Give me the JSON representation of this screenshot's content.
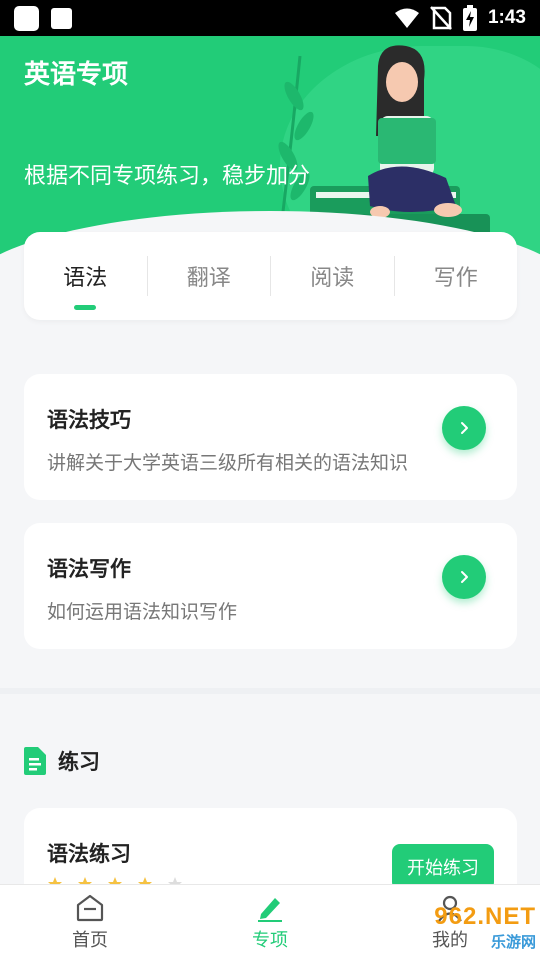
{
  "status_bar": {
    "time": "1:43"
  },
  "header": {
    "title": "英语专项",
    "subtitle": "根据不同专项练习，稳步加分"
  },
  "tabs": [
    {
      "label": "语法",
      "active": true
    },
    {
      "label": "翻译",
      "active": false
    },
    {
      "label": "阅读",
      "active": false
    },
    {
      "label": "写作",
      "active": false
    }
  ],
  "cards": [
    {
      "title": "语法技巧",
      "desc": "讲解关于大学英语三级所有相关的语法知识"
    },
    {
      "title": "语法写作",
      "desc": "如何运用语法知识写作"
    }
  ],
  "practice_section": {
    "title": "练习",
    "item": {
      "title": "语法练习",
      "rating": 4,
      "rating_max": 5,
      "button": "开始练习"
    }
  },
  "bottom_nav": [
    {
      "label": "首页",
      "icon": "home-icon",
      "active": false
    },
    {
      "label": "专项",
      "icon": "pencil-icon",
      "active": true
    },
    {
      "label": "我的",
      "icon": "person-icon",
      "active": false
    }
  ],
  "watermark": {
    "brand": "962.NET",
    "sub": "乐游网"
  },
  "colors": {
    "accent": "#22cc78",
    "header_bg": "#22cc78",
    "star": "#f5c242"
  }
}
